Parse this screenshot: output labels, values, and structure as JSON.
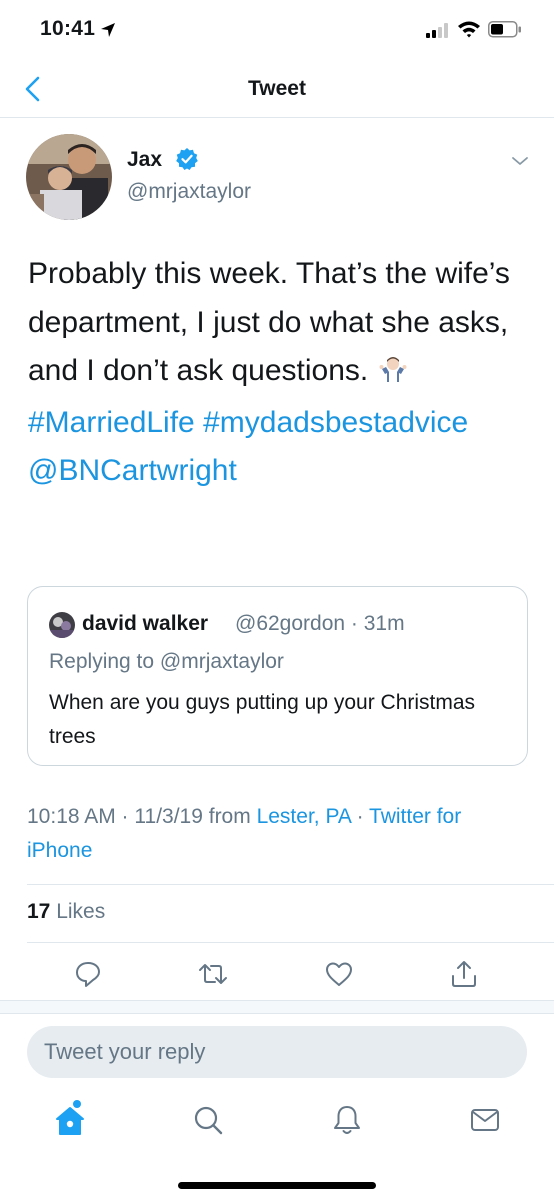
{
  "status_bar": {
    "time": "10:41"
  },
  "nav": {
    "title": "Tweet"
  },
  "tweet": {
    "author_name": "Jax",
    "author_handle": "@mrjaxtaylor",
    "text_part1": "Probably this week. That’s the wife’s department, I just do what she asks, and I don’t ask questions.",
    "hashtag1": "#MarriedLife",
    "hashtag2": "#mydadsbestadvice",
    "mention": "@BNCartwright"
  },
  "quote": {
    "name": "david walker",
    "handle_time": "@62gordon · 31m",
    "replying_prefix": "Replying to",
    "replying_handle": "@mrjaxtaylor",
    "text": "When are you guys putting up your Christmas trees"
  },
  "meta": {
    "time_date": "10:18 AM · 11/3/19 from",
    "location": "Lester, PA",
    "separator": " · ",
    "source": "Twitter for iPhone"
  },
  "stats": {
    "likes_count": "17",
    "likes_label": "Likes"
  },
  "reply": {
    "placeholder": "Tweet your reply"
  },
  "colors": {
    "accent": "#1da1f2",
    "link": "#1b95e0",
    "secondary_text": "#657786",
    "border": "#e1e8ed"
  },
  "icons": {
    "status": [
      "location-arrow-icon",
      "signal-icon",
      "wifi-icon",
      "battery-icon"
    ],
    "actions": [
      "reply-icon",
      "retweet-icon",
      "like-icon",
      "share-icon"
    ],
    "tabs": [
      "home-icon",
      "search-icon",
      "notifications-icon",
      "messages-icon"
    ]
  }
}
